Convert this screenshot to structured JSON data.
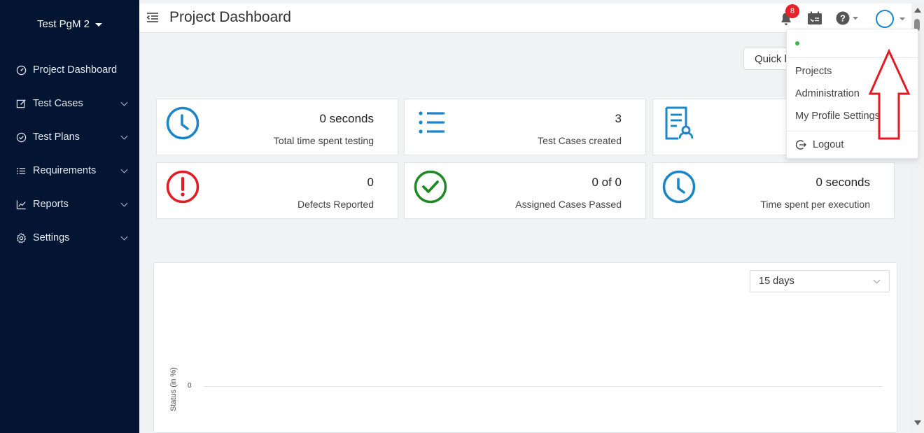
{
  "sidebar": {
    "project_name": "Test PgM 2",
    "items": [
      {
        "label": "Project Dashboard",
        "icon": "dashboard-icon"
      },
      {
        "label": "Test Cases",
        "icon": "edit-icon"
      },
      {
        "label": "Test Plans",
        "icon": "check-circle-icon"
      },
      {
        "label": "Requirements",
        "icon": "list-icon"
      },
      {
        "label": "Reports",
        "icon": "chart-line-icon"
      },
      {
        "label": "Settings",
        "icon": "gear-icon"
      }
    ]
  },
  "header": {
    "title": "Project Dashboard",
    "notification_count": "8"
  },
  "quick_button_label": "Quick l",
  "cards": [
    {
      "value": "0 seconds",
      "label": "Total time spent testing",
      "icon": "clock-icon",
      "color": "#1a86c9"
    },
    {
      "value": "3",
      "label": "Test Cases created",
      "icon": "list-icon",
      "color": "#1a86c9"
    },
    {
      "value": "",
      "label": "",
      "icon": "document-user-icon",
      "color": "#1a86c9"
    },
    {
      "value": "0",
      "label": "Defects Reported",
      "icon": "alert-icon",
      "color": "#e31b23"
    },
    {
      "value": "0 of 0",
      "label": "Assigned Cases Passed",
      "icon": "check-circle-icon",
      "color": "#1f8a24"
    },
    {
      "value": "0 seconds",
      "label": "Time spent per execution",
      "icon": "clock-icon",
      "color": "#1a86c9"
    }
  ],
  "chart_panel": {
    "range_selected": "15 days",
    "ylabel": "Status (in %)",
    "ytick": "0"
  },
  "user_menu": {
    "items": [
      "Projects",
      "Administration",
      "My Profile Settings"
    ],
    "logout": "Logout",
    "status_color": "#3bb54a"
  },
  "annotation": {
    "color": "#e31b23",
    "type": "arrow-up"
  }
}
